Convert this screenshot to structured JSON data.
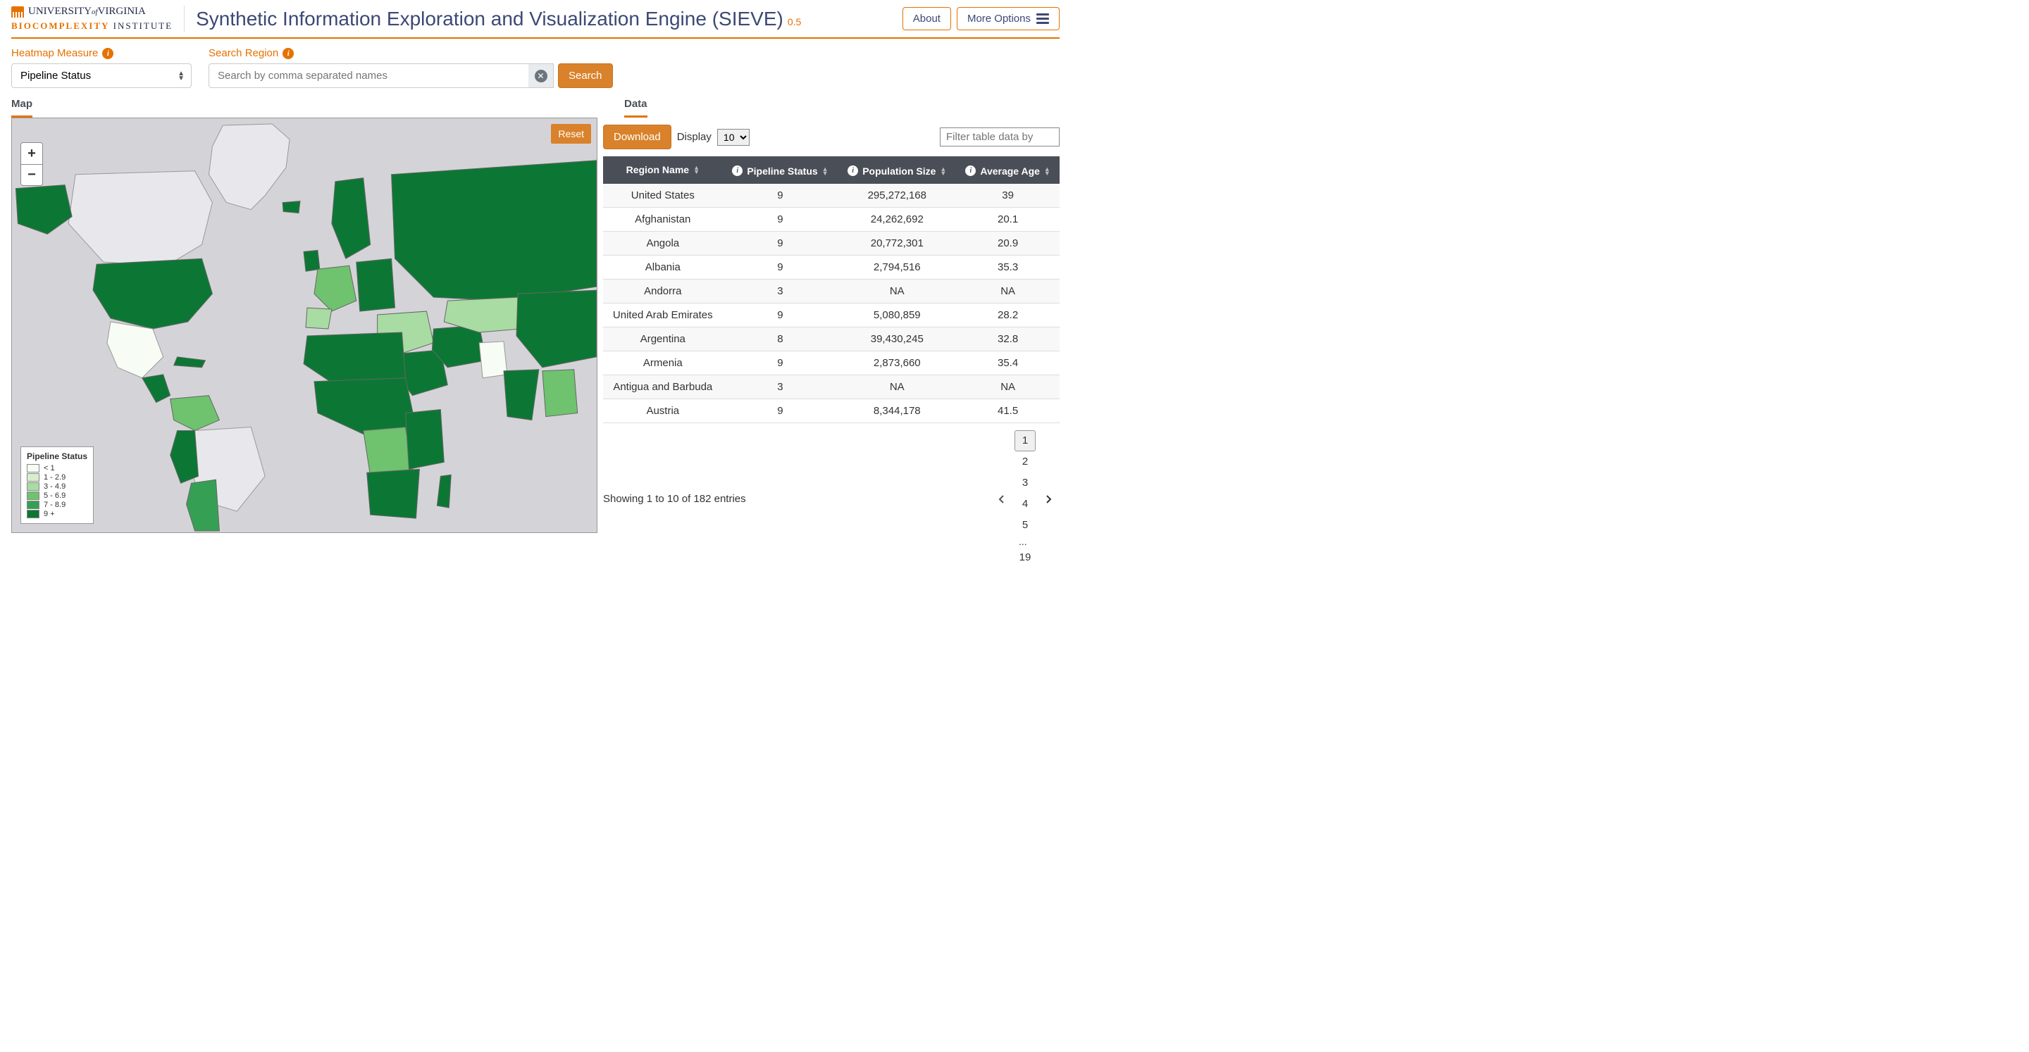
{
  "header": {
    "org_top": "UNIVERSITY",
    "org_of": "of",
    "org_end": "VIRGINIA",
    "org_sub_bold": "BIOCOMPLEXITY",
    "org_sub_rest": " INSTITUTE",
    "title": "Synthetic Information Exploration and Visualization Engine (SIEVE)",
    "version": "0.5",
    "about": "About",
    "more_options": "More Options"
  },
  "controls": {
    "heatmap_label": "Heatmap Measure",
    "heatmap_value": "Pipeline Status",
    "search_label": "Search Region",
    "search_placeholder": "Search by comma separated names",
    "search_button": "Search"
  },
  "tabs": {
    "map": "Map",
    "data": "Data"
  },
  "map": {
    "reset": "Reset",
    "zoom_in": "+",
    "zoom_out": "−",
    "legend_title": "Pipeline Status",
    "legend": [
      {
        "label": "< 1",
        "color": "#f7fcf5"
      },
      {
        "label": "1 - 2.9",
        "color": "#d6eecd"
      },
      {
        "label": "3 - 4.9",
        "color": "#a8dca2"
      },
      {
        "label": "5 - 6.9",
        "color": "#6fc26e"
      },
      {
        "label": "7 - 8.9",
        "color": "#35a054"
      },
      {
        "label": "9 +",
        "color": "#0c7734"
      }
    ]
  },
  "data_panel": {
    "download": "Download",
    "display_label": "Display",
    "display_value": "10",
    "filter_placeholder": "Filter table data by",
    "columns": [
      "Region Name",
      "Pipeline Status",
      "Population Size",
      "Average Age"
    ],
    "rows": [
      {
        "region": "United States",
        "pipeline": "9",
        "population": "295,272,168",
        "age": "39"
      },
      {
        "region": "Afghanistan",
        "pipeline": "9",
        "population": "24,262,692",
        "age": "20.1"
      },
      {
        "region": "Angola",
        "pipeline": "9",
        "population": "20,772,301",
        "age": "20.9"
      },
      {
        "region": "Albania",
        "pipeline": "9",
        "population": "2,794,516",
        "age": "35.3"
      },
      {
        "region": "Andorra",
        "pipeline": "3",
        "population": "NA",
        "age": "NA"
      },
      {
        "region": "United Arab Emirates",
        "pipeline": "9",
        "population": "5,080,859",
        "age": "28.2"
      },
      {
        "region": "Argentina",
        "pipeline": "8",
        "population": "39,430,245",
        "age": "32.8"
      },
      {
        "region": "Armenia",
        "pipeline": "9",
        "population": "2,873,660",
        "age": "35.4"
      },
      {
        "region": "Antigua and Barbuda",
        "pipeline": "3",
        "population": "NA",
        "age": "NA"
      },
      {
        "region": "Austria",
        "pipeline": "9",
        "population": "8,344,178",
        "age": "41.5"
      }
    ],
    "pager_info": "Showing 1 to 10 of 182 entries",
    "pages": [
      "1",
      "2",
      "3",
      "4",
      "5",
      "...",
      "19"
    ],
    "active_page": "1"
  },
  "chart_data": {
    "type": "heatmap",
    "title": "Pipeline Status choropleth world map",
    "measure": "Pipeline Status",
    "color_scale": [
      {
        "range": "< 1",
        "color": "#f7fcf5"
      },
      {
        "range": "1 - 2.9",
        "color": "#d6eecd"
      },
      {
        "range": "3 - 4.9",
        "color": "#a8dca2"
      },
      {
        "range": "5 - 6.9",
        "color": "#6fc26e"
      },
      {
        "range": "7 - 8.9",
        "color": "#35a054"
      },
      {
        "range": "9 +",
        "color": "#0c7734"
      }
    ],
    "sample_region_values": [
      {
        "region": "United States",
        "value": 9
      },
      {
        "region": "Afghanistan",
        "value": 9
      },
      {
        "region": "Angola",
        "value": 9
      },
      {
        "region": "Albania",
        "value": 9
      },
      {
        "region": "Andorra",
        "value": 3
      },
      {
        "region": "United Arab Emirates",
        "value": 9
      },
      {
        "region": "Argentina",
        "value": 8
      },
      {
        "region": "Armenia",
        "value": 9
      },
      {
        "region": "Antigua and Barbuda",
        "value": 3
      },
      {
        "region": "Austria",
        "value": 9
      }
    ]
  }
}
